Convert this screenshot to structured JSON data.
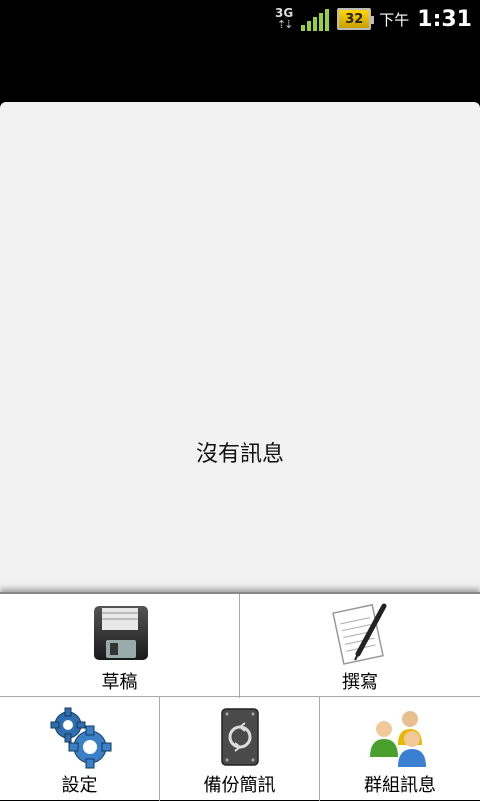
{
  "status_bar": {
    "network": "3G",
    "battery": "32",
    "ampm": "下午",
    "time": "1:31"
  },
  "main": {
    "empty_message": "沒有訊息"
  },
  "menu": {
    "drafts": "草稿",
    "compose": "撰寫",
    "settings": "設定",
    "backup": "備份簡訊",
    "group_message": "群組訊息"
  }
}
